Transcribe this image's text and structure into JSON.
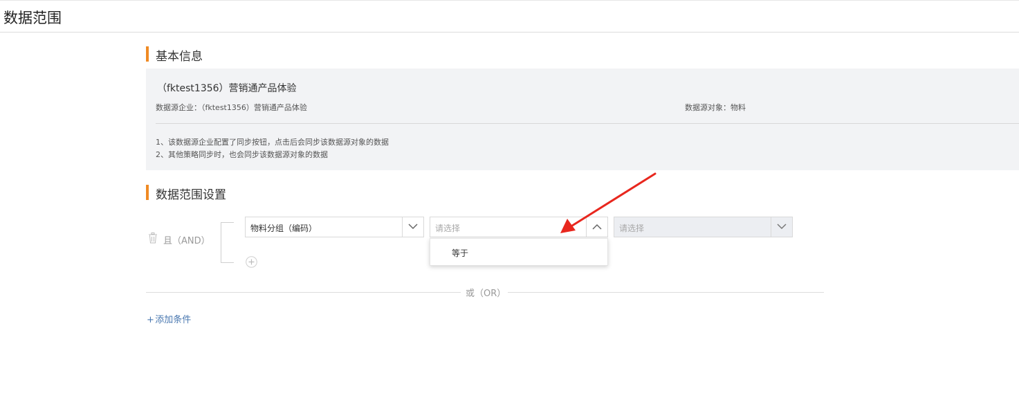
{
  "page": {
    "title": "数据范围"
  },
  "sections": {
    "basic": {
      "title": "基本信息"
    },
    "scope": {
      "title": "数据范围设置"
    }
  },
  "info": {
    "name": "（fktest1356）营销通产品体验",
    "source_enterprise_label": "数据源企业：",
    "source_enterprise_value": "（fktest1356）营销通产品体验",
    "source_object_label": "数据源对象：",
    "source_object_value": "物料",
    "notes": [
      "1、该数据源企业配置了同步按钮，点击后会同步该数据源对象的数据",
      "2、其他策略同步时，也会同步该数据源对象的数据"
    ]
  },
  "condition_group": {
    "logic_label": "且（AND）",
    "field_select": {
      "value": "物料分组（编码）"
    },
    "operator_select": {
      "placeholder": "请选择",
      "open": true,
      "options": [
        "等于"
      ]
    },
    "value_select": {
      "placeholder": "请选择",
      "disabled": true
    }
  },
  "or_divider": "或（OR）",
  "add_condition": "添加条件",
  "colors": {
    "accent_orange": "#f08a24",
    "link_blue": "#4a78b0",
    "arrow_red": "#e8271e"
  }
}
